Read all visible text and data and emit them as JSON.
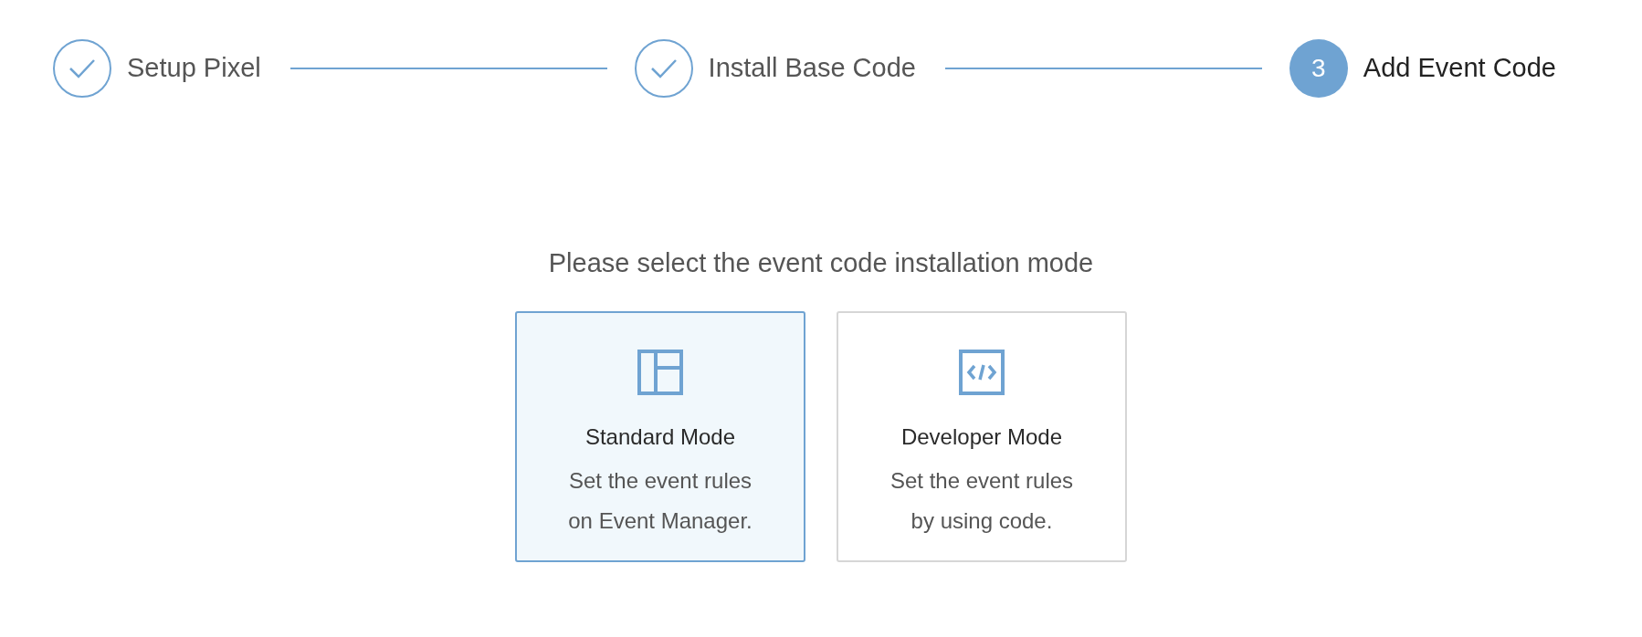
{
  "steps": [
    {
      "label": "Setup Pixel",
      "completed": true,
      "current": false
    },
    {
      "label": "Install Base Code",
      "completed": true,
      "current": false
    },
    {
      "label": "Add Event Code",
      "completed": false,
      "current": true,
      "number": "3"
    }
  ],
  "prompt": "Please select the event code installation mode",
  "modes": [
    {
      "kind": "layout",
      "title": "Standard Mode",
      "description": "Set the event rules on Event Manager.",
      "selected": true
    },
    {
      "kind": "code",
      "title": "Developer Mode",
      "description": "Set the event rules by using code.",
      "selected": false
    }
  ]
}
